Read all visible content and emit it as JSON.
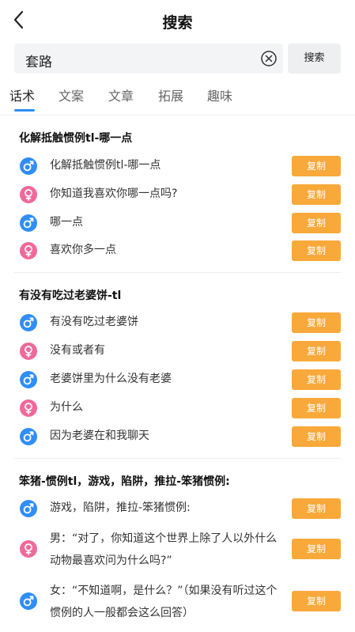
{
  "header": {
    "title": "搜索"
  },
  "search": {
    "query": "套路",
    "button_label": "搜索"
  },
  "tabs": [
    {
      "label": "话术",
      "active": true
    },
    {
      "label": "文案",
      "active": false
    },
    {
      "label": "文章",
      "active": false
    },
    {
      "label": "拓展",
      "active": false
    },
    {
      "label": "趣味",
      "active": false
    }
  ],
  "sections": [
    {
      "title": "化解抵触惯例tl-哪一点",
      "rows": [
        {
          "gender": "male",
          "text": "化解抵触惯例tl-哪一点",
          "copy": "复制"
        },
        {
          "gender": "female",
          "text": "你知道我喜欢你哪一点吗?",
          "copy": "复制"
        },
        {
          "gender": "male",
          "text": "哪一点",
          "copy": "复制"
        },
        {
          "gender": "female",
          "text": "喜欢你多一点",
          "copy": "复制"
        }
      ]
    },
    {
      "title": "有没有吃过老婆饼-tl",
      "rows": [
        {
          "gender": "male",
          "text": "有没有吃过老婆饼",
          "copy": "复制"
        },
        {
          "gender": "female",
          "text": "没有或者有",
          "copy": "复制"
        },
        {
          "gender": "male",
          "text": "老婆饼里为什么没有老婆",
          "copy": "复制"
        },
        {
          "gender": "female",
          "text": "为什么",
          "copy": "复制"
        },
        {
          "gender": "male",
          "text": "因为老婆在和我聊天",
          "copy": "复制"
        }
      ]
    },
    {
      "title": "笨猪-惯例tl，游戏，陷阱，推拉-笨猪惯例:",
      "rows": [
        {
          "gender": "male",
          "text": "游戏，陷阱，推拉-笨猪惯例:",
          "copy": "复制"
        },
        {
          "gender": "female",
          "text": "男：“对了，你知道这个世界上除了人以外什么动物最喜欢问为什么吗?”",
          "copy": "复制"
        },
        {
          "gender": "male",
          "text": "女：“不知道啊，是什么？”（如果没有听过这个惯例的人一般都会这么回答）",
          "copy": "复制"
        }
      ]
    }
  ],
  "colors": {
    "male": "#2f8ef8",
    "female": "#f0699a",
    "copy_button": "#f8a93a",
    "tab_accent": "#2f8ef8"
  },
  "icons": {
    "back": "chevron-left-icon",
    "clear": "clear-circle-icon",
    "male": "male-gender-icon",
    "female": "female-gender-icon"
  }
}
